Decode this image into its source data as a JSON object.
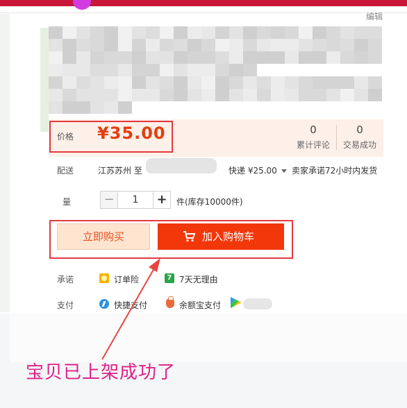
{
  "header": {
    "edit_label": "编辑"
  },
  "product": {
    "price_label": "价格",
    "price": "¥35.00",
    "stats": [
      {
        "value": "0",
        "label": "累计评论"
      },
      {
        "value": "0",
        "label": "交易成功"
      }
    ]
  },
  "delivery": {
    "label": "配送",
    "from": "江苏苏州 至",
    "shipping_fee": "快递 ¥25.00",
    "promise": "卖家承诺72小时内发货"
  },
  "quantity": {
    "label": "数量",
    "label_visible": "量",
    "minus": "−",
    "value": "1",
    "plus": "+",
    "stock": "件(库存10000件)"
  },
  "actions": {
    "buy_now": "立即购买",
    "add_to_cart": "加入购物车"
  },
  "guarantee": {
    "label": "承诺",
    "items": [
      "订单险",
      "7天无理由"
    ]
  },
  "payment": {
    "label": "支付",
    "items": [
      "快捷支付",
      "余额宝支付"
    ],
    "items_visible": [
      "快捷支付",
      "余额宝支付"
    ]
  },
  "annotation": {
    "caption": "宝贝已上架成功了"
  },
  "colors": {
    "accent_red": "#e5383e",
    "price_orange": "#e43e0f",
    "cart_button": "#f2380b",
    "caption_pink": "#e0208a"
  },
  "icons": {
    "seven_day": "7",
    "cart": "cart-icon"
  }
}
